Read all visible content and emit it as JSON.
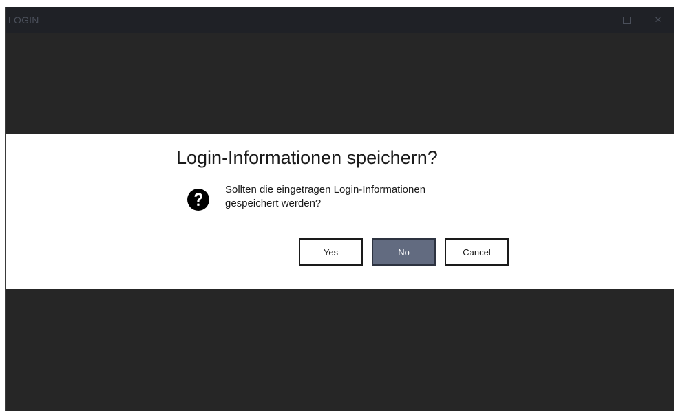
{
  "window": {
    "title": "LOGIN",
    "controls": {
      "minimize": "–",
      "close": "✕"
    }
  },
  "dialog": {
    "title": "Login-Informationen speichern?",
    "message_line1": "Sollten die eingetragen Login-Informationen",
    "message_line2": "gespeichert werden?",
    "icon": "question-circle-icon",
    "buttons": {
      "yes": "Yes",
      "no": "No",
      "cancel": "Cancel"
    },
    "default_button": "no"
  },
  "colors": {
    "background": "#262626",
    "titlebar": "#1f2126",
    "dialog_band": "#ffffff",
    "primary_button": "#626b80"
  }
}
